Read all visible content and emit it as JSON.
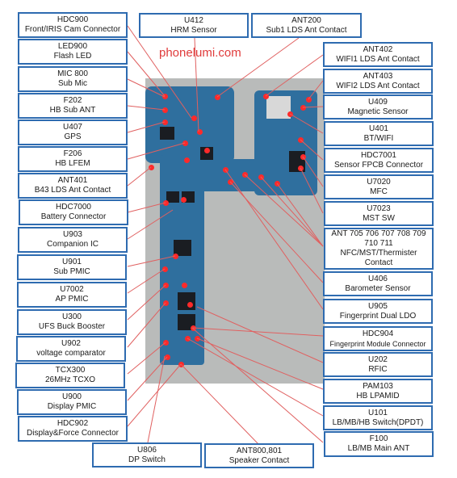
{
  "watermark": "phonelumi.com",
  "colors": {
    "label_border": "#2e6bb0",
    "leader_line": "#e06060",
    "marker": "#ff2a2a",
    "board": "#2f6f9e"
  },
  "labels": {
    "left": [
      {
        "id": "HDC900",
        "desc": "Front/IRIS Cam Connector"
      },
      {
        "id": "LED900",
        "desc": "Flash LED"
      },
      {
        "id": "MIC 800",
        "desc": "Sub Mic"
      },
      {
        "id": "F202",
        "desc": "HB Sub ANT"
      },
      {
        "id": "U407",
        "desc": "GPS"
      },
      {
        "id": "F206",
        "desc": "HB LFEM"
      },
      {
        "id": "ANT401",
        "desc": "B43 LDS Ant Contact"
      },
      {
        "id": "HDC7000",
        "desc": "Battery Connector"
      },
      {
        "id": "U903",
        "desc": "Companion IC"
      },
      {
        "id": "U901",
        "desc": "Sub PMIC"
      },
      {
        "id": "U7002",
        "desc": "AP PMIC"
      },
      {
        "id": "U300",
        "desc": "UFS Buck Booster"
      },
      {
        "id": "U902",
        "desc": "voltage comparator"
      },
      {
        "id": "TCX300",
        "desc": "26MHz TCXO"
      },
      {
        "id": "U900",
        "desc": "Display PMIC"
      },
      {
        "id": "HDC902",
        "desc": "Display&Force Connector"
      }
    ],
    "top": [
      {
        "id": "U412",
        "desc": "HRM Sensor"
      },
      {
        "id": "ANT200",
        "desc": "Sub1 LDS Ant Contact"
      }
    ],
    "right": [
      {
        "id": "ANT402",
        "desc": "WIFI1 LDS Ant Contact"
      },
      {
        "id": "ANT403",
        "desc": "WIFI2 LDS Ant Contact"
      },
      {
        "id": "U409",
        "desc": "Magnetic Sensor"
      },
      {
        "id": "U401",
        "desc": "BT/WIFI"
      },
      {
        "id": "HDC7001",
        "desc": "Sensor FPCB Connector"
      },
      {
        "id": "U7020",
        "desc": "MFC"
      },
      {
        "id": "U7023",
        "desc": "MST SW"
      },
      {
        "id": "ANT 705 706 707 708 709 710 711",
        "desc": "NFC/MST/Thermister Contact"
      },
      {
        "id": "U406",
        "desc": "Barometer Sensor"
      },
      {
        "id": "U905",
        "desc": "Fingerprint Dual LDO"
      },
      {
        "id": "HDC904",
        "desc": "Fingerprint Module Connector"
      },
      {
        "id": "U202",
        "desc": "RFIC"
      },
      {
        "id": "PAM103",
        "desc": "HB LPAMID"
      },
      {
        "id": "U101",
        "desc": "LB/MB/HB Switch(DPDT)"
      },
      {
        "id": "F100",
        "desc": "LB/MB Main ANT"
      }
    ],
    "bottom": [
      {
        "id": "U806",
        "desc": "DP Switch"
      },
      {
        "id": "ANT800,801",
        "desc": "Speaker Contact"
      }
    ]
  }
}
